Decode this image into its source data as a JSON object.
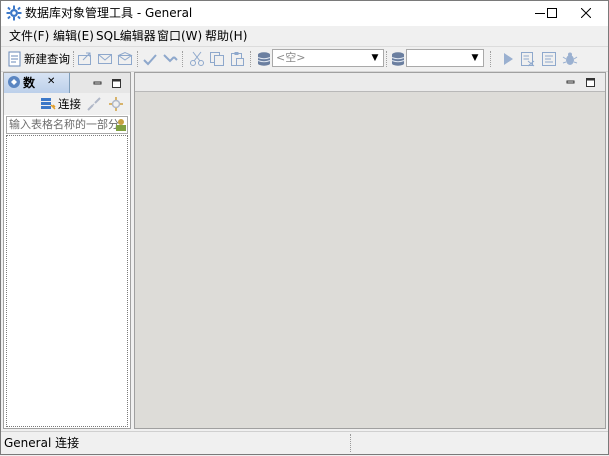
{
  "window": {
    "title": "数据库对象管理工具 - General",
    "minimize_glyph": "—",
    "maximize_glyph": "☐",
    "close_glyph": "✕"
  },
  "menu": {
    "file": "文件(F)",
    "edit": "编辑(E)",
    "sql_editor": "SQL编辑器",
    "window": "窗口(W)",
    "help": "帮助(H)"
  },
  "toolbar": {
    "new_query": "新建查询",
    "connection_combo_value": "<空>",
    "icons": [
      "export-icon",
      "mail-icon",
      "mail-icon",
      "commit-icon",
      "rollback-icon",
      "cut-icon",
      "copy-icon",
      "paste-icon",
      "database-icon",
      "database-icon",
      "run-icon",
      "explain-icon",
      "format-icon",
      "debug-icon"
    ]
  },
  "left_panel": {
    "tab_label": "数",
    "tab_close_glyph": "✕",
    "connect_label": "连接",
    "filter_placeholder": "输入表格名称的一部分"
  },
  "status_bar": {
    "text": "General 连接"
  },
  "colors": {
    "accent": "#3c78c8",
    "editor_bg": "#dddcd8",
    "chrome_bg": "#f0f0f0"
  }
}
